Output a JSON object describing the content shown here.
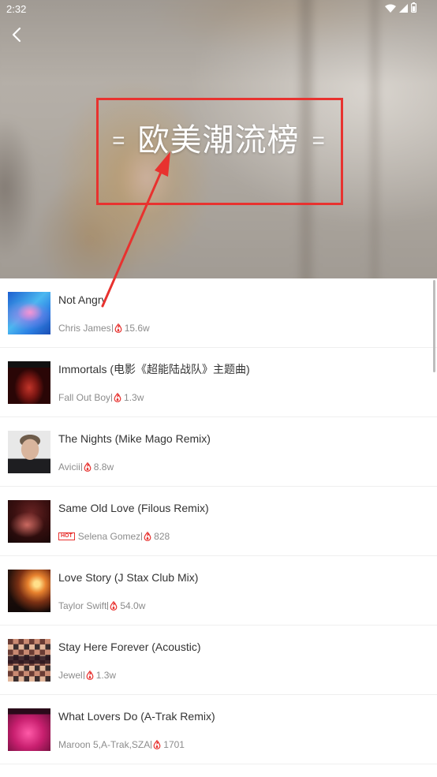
{
  "status_bar": {
    "time": "2:32"
  },
  "header": {
    "deco_left": "=",
    "title": "欧美潮流榜",
    "deco_right": "="
  },
  "songs": [
    {
      "title": "Not Angry",
      "artist": "Chris James",
      "plays": "15.6w"
    },
    {
      "title": "Immortals (电影《超能陆战队》主题曲)",
      "artist": "Fall Out Boy",
      "plays": "1.3w"
    },
    {
      "title": "The Nights (Mike Mago Remix)",
      "artist": "Avicii",
      "plays": "8.8w"
    },
    {
      "title": "Same Old Love (Filous Remix)",
      "badge": "HOT",
      "artist": "Selena Gomez",
      "plays": "828"
    },
    {
      "title": "Love Story (J Stax Club Mix)",
      "artist": "Taylor Swift",
      "plays": "54.0w"
    },
    {
      "title": "Stay Here Forever (Acoustic)",
      "artist": "Jewel",
      "plays": "1.3w"
    },
    {
      "title": "What Lovers Do (A-Trak Remix)",
      "artist": "Maroon 5,A-Trak,SZA",
      "plays": "1701"
    }
  ],
  "icons": {
    "back": "chevron-left-icon",
    "plays": "flame-icon",
    "wifi": "wifi-icon",
    "signal": "cellular-signal-icon",
    "battery": "battery-icon"
  },
  "colors": {
    "accent_red": "#e8322f",
    "title_text": "#333333",
    "meta_text": "#8c8c8c",
    "divider": "#efefef"
  }
}
